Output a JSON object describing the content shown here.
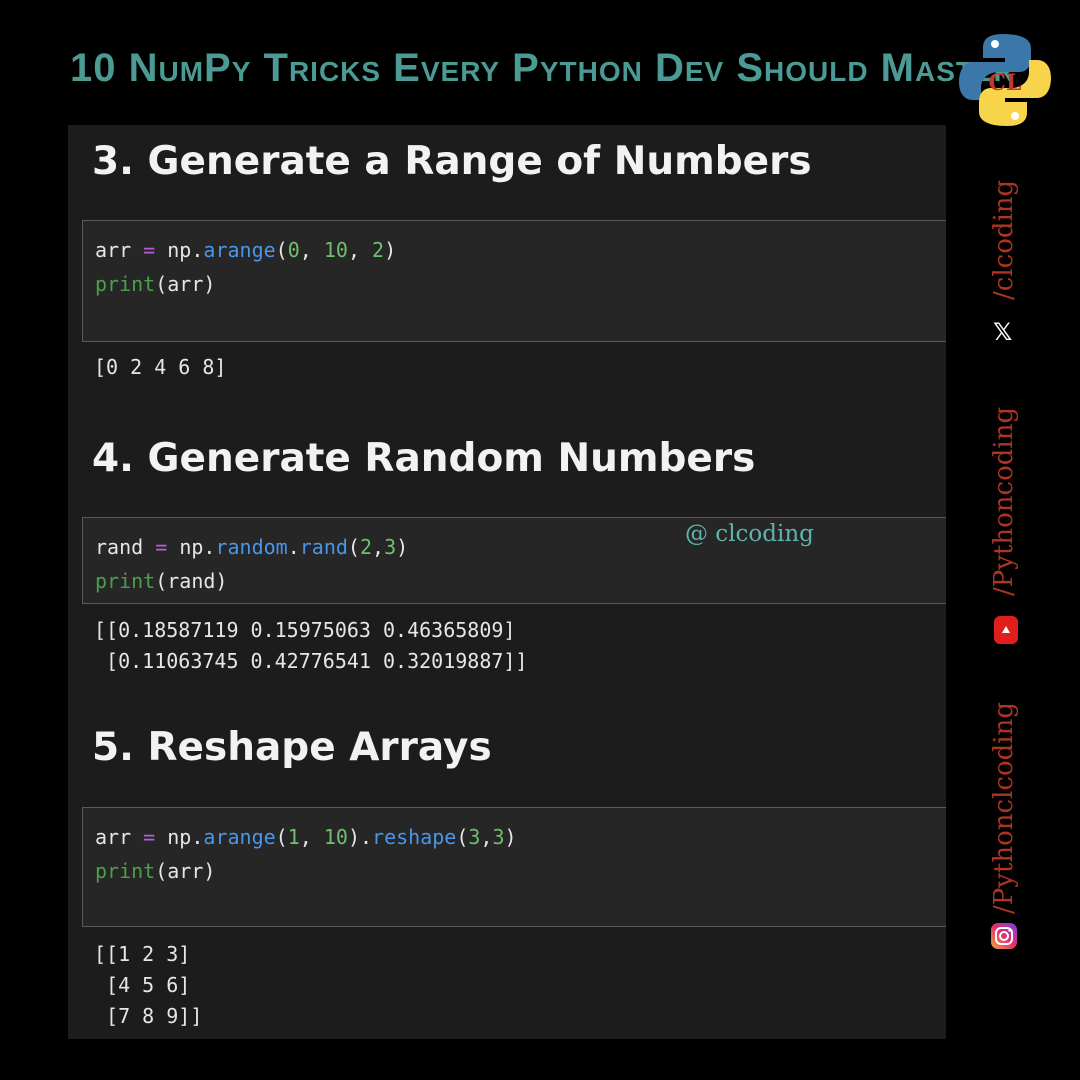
{
  "title": "10 NumPy Tricks Every Python Dev Should Master",
  "logo_text": "CL",
  "watermark": "@ clcoding",
  "sections": [
    {
      "heading": "3. Generate a Range of Numbers",
      "code": [
        {
          "var": "arr",
          "eq": "=",
          "obj": "np",
          "dot": ".",
          "method": "arange",
          "open": "(",
          "a1": "0",
          "c1": ", ",
          "a2": "10",
          "c2": ", ",
          "a3": "2",
          "close": ")"
        },
        {
          "fn": "print",
          "args": "(arr)"
        }
      ],
      "output": "[0 2 4 6 8]"
    },
    {
      "heading": "4. Generate Random Numbers",
      "code": [
        {
          "var": "rand",
          "eq": "=",
          "obj": "np",
          "dot1": ".",
          "mod": "random",
          "dot2": ".",
          "method": "rand",
          "open": "(",
          "a1": "2",
          "c1": ",",
          "a2": "3",
          "close": ")"
        },
        {
          "fn": "print",
          "args": "(rand)"
        }
      ],
      "output": "[[0.18587119 0.15975063 0.46365809]\n [0.11063745 0.42776541 0.32019887]]"
    },
    {
      "heading": "5. Reshape Arrays",
      "code": [
        {
          "var": "arr",
          "eq": "=",
          "obj": "np",
          "dot1": ".",
          "method": "arange",
          "open": "(",
          "a1": "1",
          "c1": ", ",
          "a2": "10",
          "close1": ")",
          "dot2": ".",
          "method2": "reshape",
          "open2": "(",
          "b1": "3",
          "c2": ",",
          "b2": "3",
          "close2": ")"
        },
        {
          "fn": "print",
          "args": "(arr)"
        }
      ],
      "output": "[[1 2 3]\n [4 5 6]\n [7 8 9]]"
    }
  ],
  "social": {
    "twitter": "/clcoding",
    "youtube": "/Pythoncoding",
    "instagram": "/Pythonclcoding"
  },
  "colors": {
    "title": "#4c9a94",
    "social_text": "#b03422",
    "youtube": "#e01e1e",
    "panel_bg": "#1c1c1c"
  },
  "icons": [
    "python-logo-icon",
    "x-twitter-icon",
    "youtube-icon",
    "instagram-icon"
  ]
}
